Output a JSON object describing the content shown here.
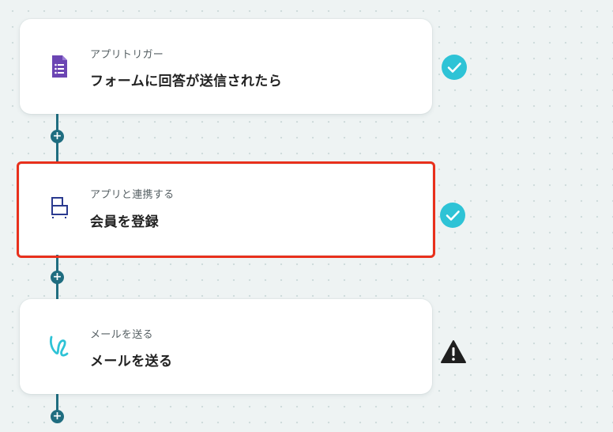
{
  "flow": {
    "steps": [
      {
        "caption": "アプリトリガー",
        "title": "フォームに回答が送信されたら",
        "icon": "google-forms-icon",
        "status": "complete"
      },
      {
        "caption": "アプリと連携する",
        "title": "会員を登録",
        "icon": "member-app-icon",
        "status": "complete",
        "selected": true
      },
      {
        "caption": "メールを送る",
        "title": "メールを送る",
        "icon": "mail-send-icon",
        "status": "warning"
      }
    ],
    "add_step_label": "+"
  },
  "colors": {
    "background": "#eef3f3",
    "connector": "#1f6d80",
    "check_badge": "#2ec3d6",
    "warning": "#1f1f1f",
    "selected_outline": "#e8301c",
    "forms_purple": "#6b45b3",
    "member_icon_navy": "#2a3a8f",
    "mail_icon_cyan": "#2ec3d6"
  }
}
